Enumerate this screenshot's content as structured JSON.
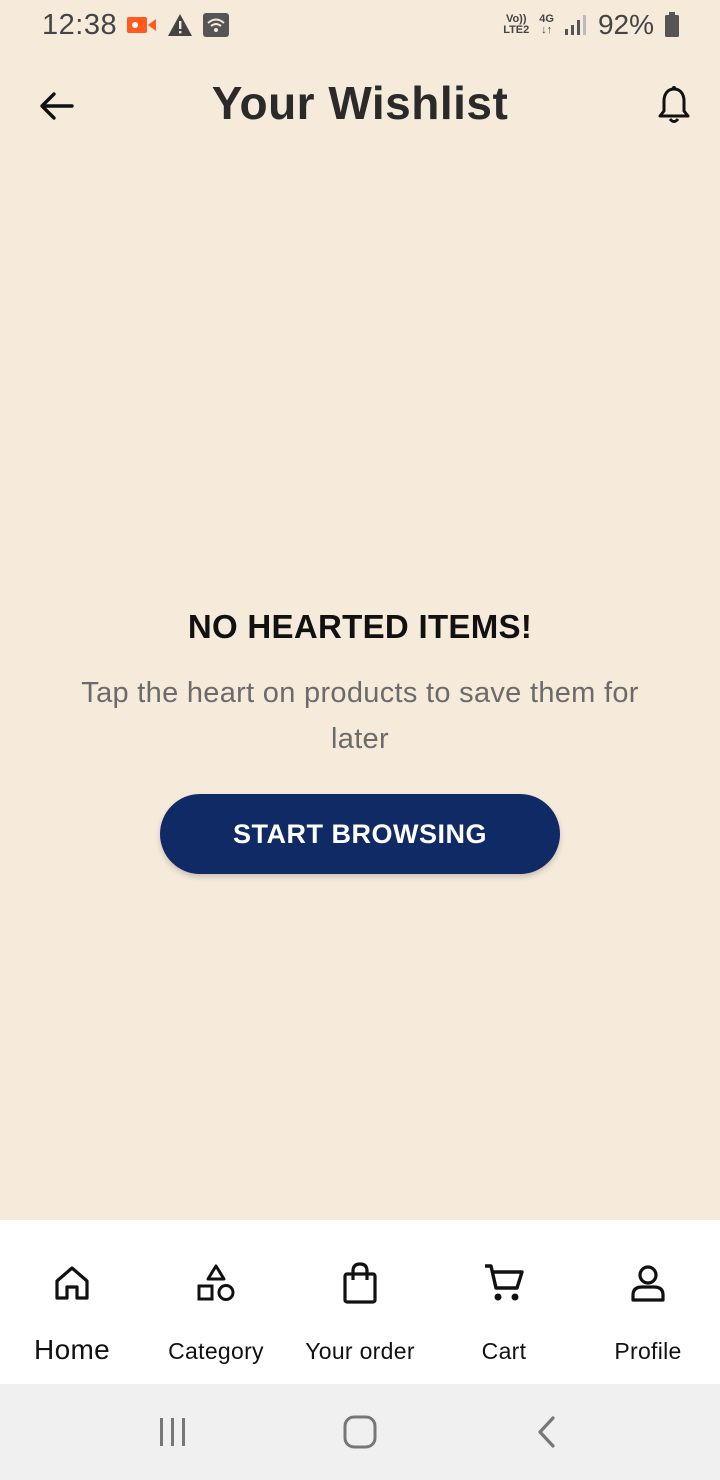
{
  "status_bar": {
    "time": "12:38",
    "network_top": "Vo))",
    "network_bottom": "LTE2",
    "network_gen": "4G",
    "battery": "92%",
    "icons": [
      "video-record-icon",
      "warning-icon",
      "wifi-icon",
      "signal-icon",
      "battery-icon"
    ],
    "record_color": "#ff5a1f"
  },
  "app_bar": {
    "title": "Your Wishlist",
    "back_icon": "arrow-left-icon",
    "notification_icon": "bell-icon"
  },
  "empty_state": {
    "title": "NO HEARTED ITEMS!",
    "subtitle": "Tap the heart on products to save them for later",
    "button_label": "START BROWSING",
    "button_color": "#0f2a64"
  },
  "bottom_nav": {
    "items": [
      {
        "label": "Home",
        "icon": "home-icon"
      },
      {
        "label": "Category",
        "icon": "shapes-icon"
      },
      {
        "label": "Your order",
        "icon": "shopping-bag-icon"
      },
      {
        "label": "Cart",
        "icon": "cart-icon"
      },
      {
        "label": "Profile",
        "icon": "profile-icon"
      }
    ]
  },
  "system_nav": {
    "icons": [
      "recent-apps-icon",
      "home-circle-icon",
      "back-chevron-icon"
    ]
  },
  "colors": {
    "background": "#f6eadb",
    "nav_background": "#ffffff",
    "system_nav_background": "#f0f0f0"
  }
}
